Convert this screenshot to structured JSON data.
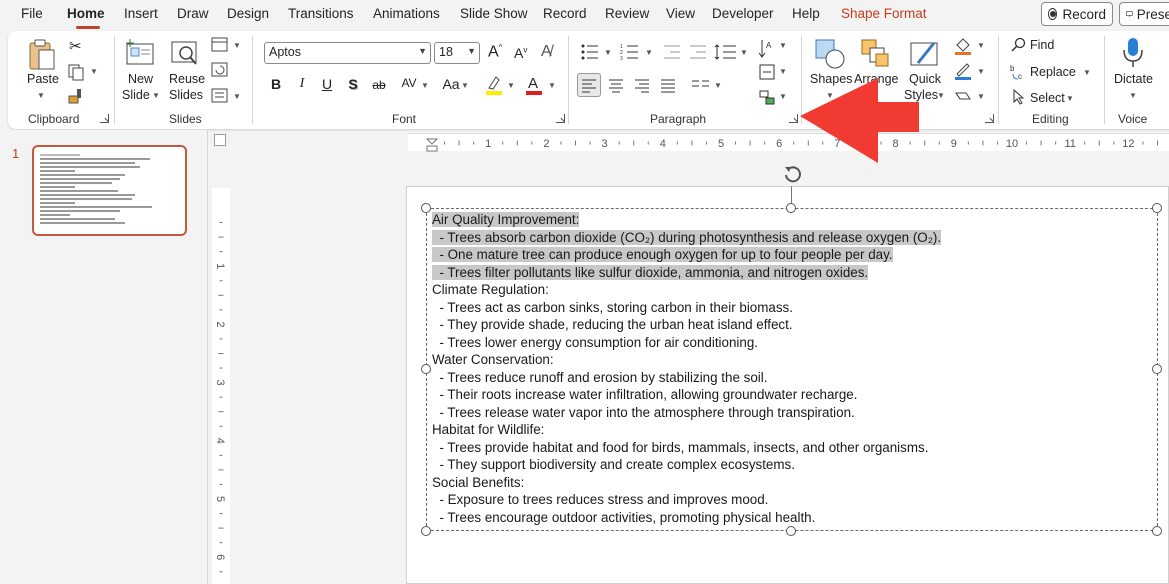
{
  "tabs": [
    "File",
    "Home",
    "Insert",
    "Draw",
    "Design",
    "Transitions",
    "Animations",
    "Slide Show",
    "Record",
    "Review",
    "View",
    "Developer",
    "Help",
    "Shape Format"
  ],
  "active_tab": "Home",
  "top_buttons": {
    "record": "Record",
    "present": "Prese"
  },
  "clipboard": {
    "paste": "Paste",
    "group": "Clipboard"
  },
  "slides": {
    "new_slide_1": "New",
    "new_slide_2": "Slide",
    "reuse_1": "Reuse",
    "reuse_2": "Slides",
    "group": "Slides"
  },
  "font": {
    "name": "Aptos",
    "size": "18",
    "group": "Font",
    "bold": "B",
    "italic": "I",
    "underline": "U",
    "shadow": "S",
    "strike": "ab",
    "spacing": "AV",
    "case": "Aa",
    "grow": "A",
    "shrink": "A"
  },
  "paragraph": {
    "group": "Paragraph"
  },
  "drawing": {
    "shapes": "Shapes",
    "arrange": "Arrange",
    "quick_1": "Quick",
    "quick_2": "Styles"
  },
  "editing": {
    "find": "Find",
    "replace": "Replace",
    "select": "Select",
    "group": "Editing"
  },
  "voice": {
    "dictate": "Dictate",
    "group": "Voice"
  },
  "ruler": {
    "h_ticks": [
      "1",
      "2",
      "3",
      "4",
      "5",
      "6",
      "7",
      "8",
      "9",
      "10",
      "11",
      "12"
    ],
    "v_ticks": [
      "1",
      "2",
      "3",
      "4",
      "5",
      "6"
    ]
  },
  "thumbnail": {
    "number": "1"
  },
  "text_lines": [
    {
      "text": "Air Quality Improvement:",
      "hl": true
    },
    {
      "text": "  - Trees absorb carbon dioxide (CO₂) during photosynthesis and release oxygen (O₂).",
      "hl": true
    },
    {
      "text": "  - One mature tree can produce enough oxygen for up to four people per day.",
      "hl": true
    },
    {
      "text": "  - Trees filter pollutants like sulfur dioxide, ammonia, and nitrogen oxides.",
      "hl": true
    },
    {
      "text": "Climate Regulation:",
      "hl": false
    },
    {
      "text": "  - Trees act as carbon sinks, storing carbon in their biomass.",
      "hl": false
    },
    {
      "text": "  - They provide shade, reducing the urban heat island effect.",
      "hl": false
    },
    {
      "text": "  - Trees lower energy consumption for air conditioning.",
      "hl": false
    },
    {
      "text": "Water Conservation:",
      "hl": false
    },
    {
      "text": "  - Trees reduce runoff and erosion by stabilizing the soil.",
      "hl": false
    },
    {
      "text": "  - Their roots increase water infiltration, allowing groundwater recharge.",
      "hl": false
    },
    {
      "text": "  - Trees release water vapor into the atmosphere through transpiration.",
      "hl": false
    },
    {
      "text": "Habitat for Wildlife:",
      "hl": false
    },
    {
      "text": "  - Trees provide habitat and food for birds, mammals, insects, and other organisms.",
      "hl": false
    },
    {
      "text": "  - They support biodiversity and create complex ecosystems.",
      "hl": false
    },
    {
      "text": "Social Benefits:",
      "hl": false
    },
    {
      "text": "  - Exposure to trees reduces stress and improves mood.",
      "hl": false
    },
    {
      "text": "  - Trees encourage outdoor activities, promoting physical health.",
      "hl": false
    }
  ],
  "colors": {
    "accent": "#b7472a",
    "arrow": "#f03a32",
    "highlight": "#c8c8c8"
  }
}
